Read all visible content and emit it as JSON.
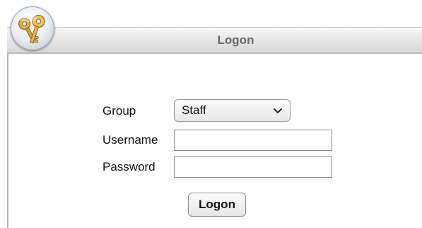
{
  "window": {
    "title": "Logon",
    "logo_icon": "keys-icon"
  },
  "form": {
    "group_label": "Group",
    "group_selected": "Staff",
    "username_label": "Username",
    "username_value": "",
    "password_label": "Password",
    "password_value": "",
    "submit_label": "Logon"
  },
  "colors": {
    "title_text": "#6b6b6b",
    "title_bar": "#e9e9e9",
    "key_gold": "#d9a23a"
  }
}
